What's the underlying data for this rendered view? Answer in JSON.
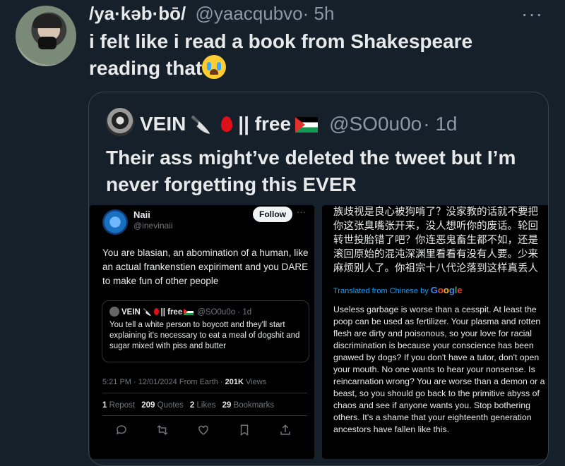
{
  "tweet": {
    "display_name": "/ya·kəb·bō/",
    "handle": "@yaacqubvo",
    "time": "· 5h",
    "text": "i felt like i read a book from Shakespeare reading that",
    "more_icon": "more-horizontal-icon"
  },
  "quote": {
    "name": "VEIN",
    "separator": "|| free",
    "handle": "@SO0u0o",
    "time": "· 1d",
    "text": "Their ass might’ve deleted the tweet but I’m never forgetting this EVER"
  },
  "left_screenshot": {
    "name": "Naii",
    "handle": "@inevinaii",
    "follow_label": "Follow",
    "more": "···",
    "text": "You are blasian, an abomination of a human, like an actual frankenstien expiriment and you DARE to make fun of other people",
    "inner_quote": {
      "name": "VEIN",
      "separator": "|| free",
      "handle": "@SO0u0o · 1d",
      "text": "You tell a white person to boycott and they'll start explaining it's necessary to eat a meal of dogshit and sugar mixed with piss and butter"
    },
    "meta_time": "5:21 PM · 12/01/2024 From Earth · ",
    "views_count": "201K",
    "views_label": " Views",
    "stats": {
      "reposts_count": "1",
      "reposts_label": "Repost",
      "quotes_count": "209",
      "quotes_label": "Quotes",
      "likes_count": "2",
      "likes_label": "Likes",
      "bookmarks_count": "29",
      "bookmarks_label": "Bookmarks"
    }
  },
  "right_screenshot": {
    "chinese_text": "族歧视是良心被狗啃了？没家教的话就不要把你这张臭嘴张开来，没人想听你的废话。轮回转世投胎错了吧？你连恶鬼畜生都不如，还是滚回原始的混沌深渊里看看有没有人要。少来麻烦别人了。你祖宗十八代沦落到这样真丢人",
    "translated_label": "Translated from Chinese by",
    "google_letters": [
      "G",
      "o",
      "o",
      "g",
      "l",
      "e"
    ],
    "english_text": "Useless garbage is worse than a cesspit. At least the poop can be used as fertilizer. Your plasma and rotten flesh are dirty and poisonous, so your love for racial discrimination is because your conscience has been gnawed by dogs? If you don't have a tutor, don't open your mouth. No one wants to hear your nonsense. Is reincarnation wrong? You are worse than a demon or a beast, so you should go back to the primitive abyss of chaos and see if anyone wants you. Stop bothering others. It's a shame that your eighteenth generation ancestors have fallen like this."
  },
  "colors": {
    "background": "#15202b",
    "text": "#e7e9ea",
    "secondary": "#8b98a5",
    "link": "#1d9bf0"
  }
}
